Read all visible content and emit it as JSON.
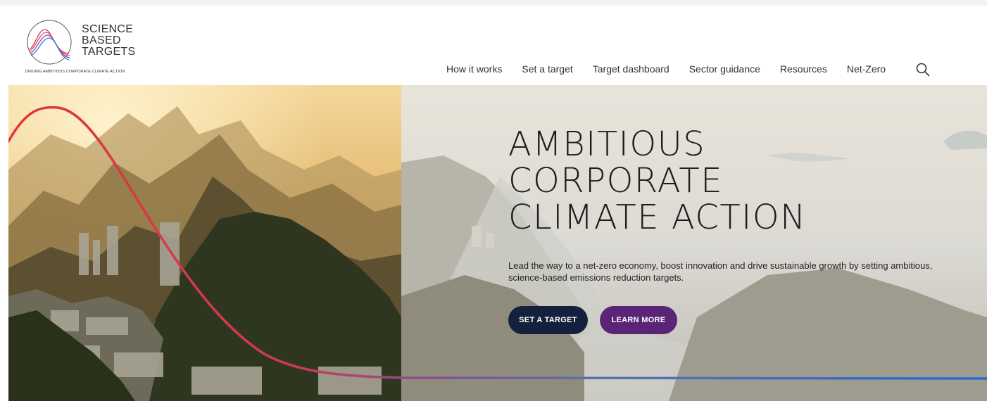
{
  "logo": {
    "lines": [
      "SCIENCE",
      "BASED",
      "TARGETS"
    ],
    "tagline": "DRIVING AMBITIOUS CORPORATE CLIMATE ACTION"
  },
  "nav": {
    "items": [
      {
        "label": "How it works"
      },
      {
        "label": "Set a target"
      },
      {
        "label": "Target dashboard"
      },
      {
        "label": "Sector guidance"
      },
      {
        "label": "Resources"
      },
      {
        "label": "Net-Zero"
      }
    ],
    "search_icon": "search-icon"
  },
  "hero": {
    "title_lines": [
      "AMBITIOUS",
      "CORPORATE",
      "CLIMATE ACTION"
    ],
    "subtitle": "Lead the way to a net-zero economy, boost innovation and drive sustainable growth by setting ambitious, science-based emissions reduction targets.",
    "buttons": {
      "set_target": "SET A TARGET",
      "learn_more": "LEARN MORE"
    }
  },
  "colors": {
    "set_target_bg": "#15203c",
    "learn_more_bg": "#5b2577",
    "curve_start": "#e0343f",
    "curve_end": "#2a6ad1"
  }
}
